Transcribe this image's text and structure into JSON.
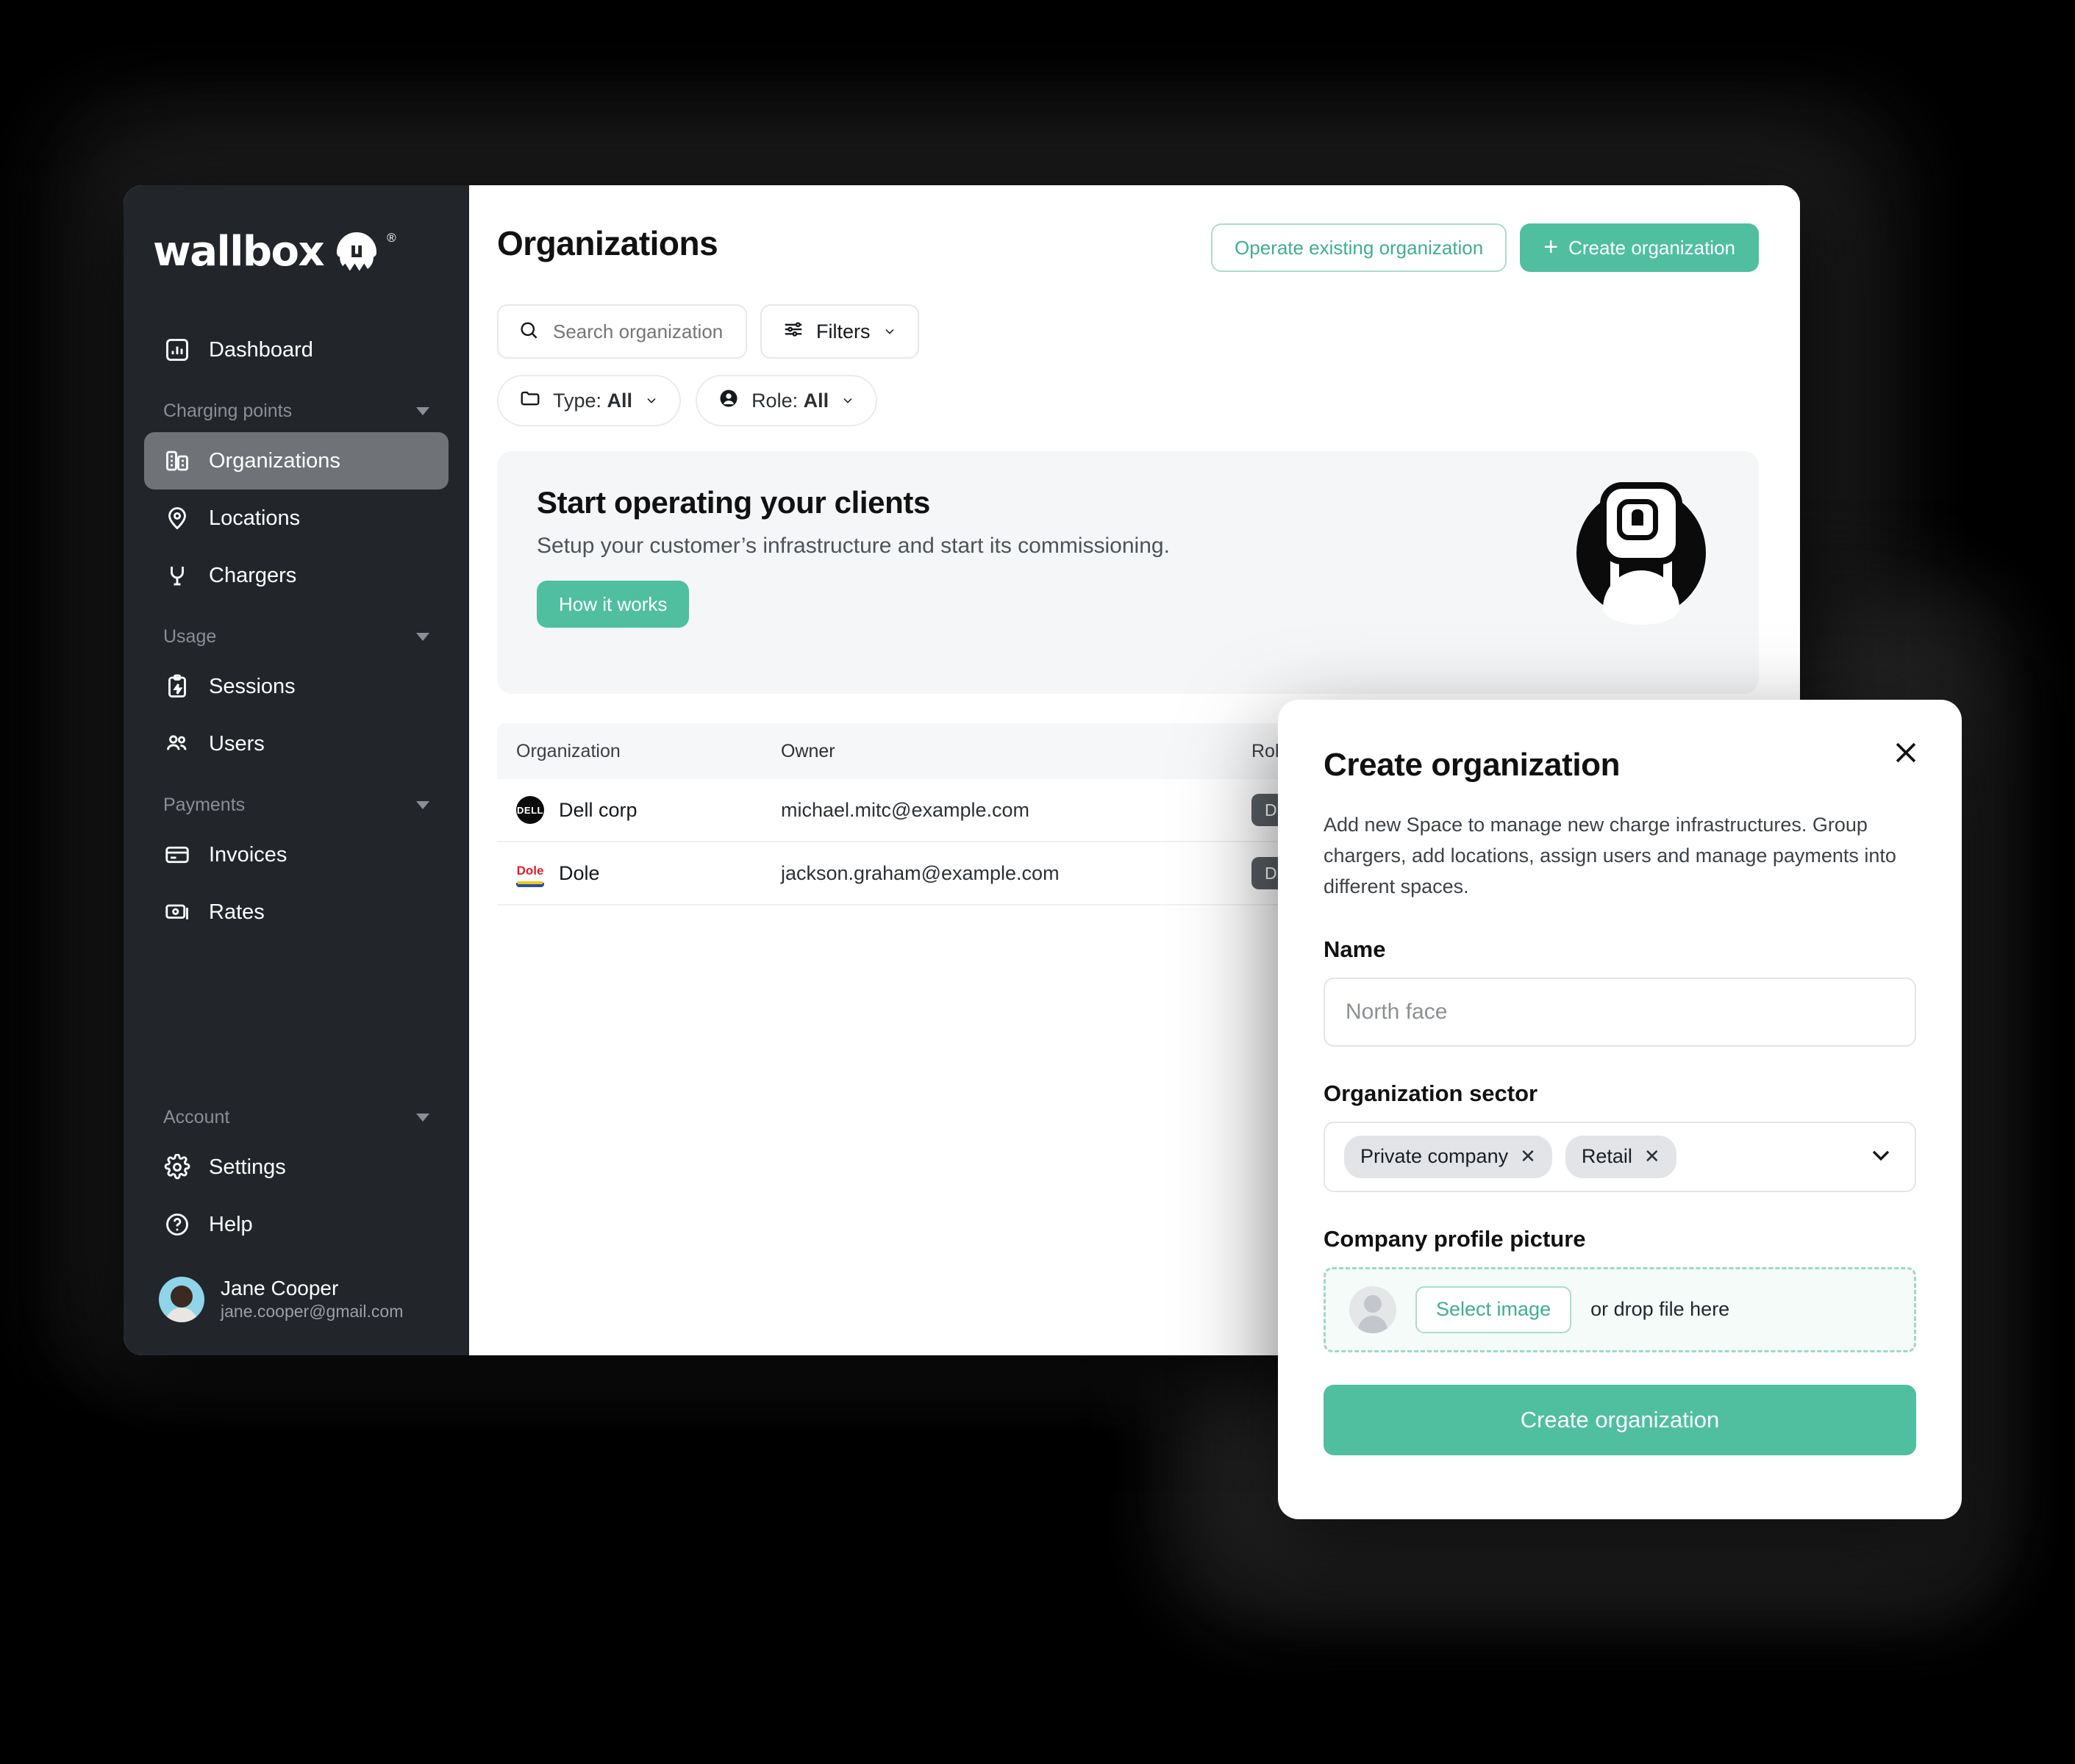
{
  "brand": {
    "name": "wallbox",
    "registered": "®",
    "accent": "#4fbfa0",
    "sidebar_bg": "#22252a"
  },
  "sidebar": {
    "items": [
      {
        "label": "Dashboard",
        "icon": "dashboard-icon",
        "type": "item",
        "active": false
      },
      {
        "label": "Charging points",
        "icon": "chevron-down-icon",
        "type": "group"
      },
      {
        "label": "Organizations",
        "icon": "organizations-icon",
        "type": "item",
        "active": true
      },
      {
        "label": "Locations",
        "icon": "location-pin-icon",
        "type": "item",
        "active": false
      },
      {
        "label": "Chargers",
        "icon": "plug-icon",
        "type": "item",
        "active": false
      },
      {
        "label": "Usage",
        "icon": "chevron-down-icon",
        "type": "group"
      },
      {
        "label": "Sessions",
        "icon": "clipboard-bolt-icon",
        "type": "item",
        "active": false
      },
      {
        "label": "Users",
        "icon": "users-icon",
        "type": "item",
        "active": false
      },
      {
        "label": "Payments",
        "icon": "chevron-down-icon",
        "type": "group"
      },
      {
        "label": "Invoices",
        "icon": "credit-card-icon",
        "type": "item",
        "active": false
      },
      {
        "label": "Rates",
        "icon": "banknote-icon",
        "type": "item",
        "active": false
      }
    ],
    "account_group": "Account",
    "account_items": [
      {
        "label": "Settings",
        "icon": "gear-icon"
      },
      {
        "label": "Help",
        "icon": "question-circle-icon"
      }
    ],
    "user": {
      "name": "Jane Cooper",
      "email": "jane.cooper@gmail.com"
    }
  },
  "page": {
    "title": "Organizations",
    "operate_button": "Operate existing organization",
    "create_button": "Create  organization"
  },
  "search": {
    "placeholder": "Search organization"
  },
  "filters": {
    "label": "Filters"
  },
  "chips": [
    {
      "prefix": "Type: ",
      "value": "All",
      "icon": "folder-icon"
    },
    {
      "prefix": "Role: ",
      "value": "All",
      "icon": "person-circle-icon"
    }
  ],
  "banner": {
    "title": "Start operating your clients",
    "subtitle": "Setup your customer’s infrastructure and start its commissioning.",
    "cta": "How it works"
  },
  "table": {
    "columns": [
      "Organization",
      "Owner",
      "Role"
    ],
    "rows": [
      {
        "organization": "Dell corp",
        "logo": "DELL",
        "owner": "michael.mitc@example.com",
        "role": "Driver"
      },
      {
        "organization": "Dole",
        "logo": "Dole",
        "owner": "jackson.graham@example.com",
        "role": "Driver"
      }
    ]
  },
  "modal": {
    "title": "Create organization",
    "description": "Add new Space to manage new charge infrastructures. Group chargers, add locations, assign users and manage payments into different spaces.",
    "name_label": "Name",
    "name_placeholder": "North face",
    "sector_label": "Organization sector",
    "sector_tags": [
      "Private company",
      "Retail"
    ],
    "tag_remove": "✕",
    "picture_label": "Company profile picture",
    "select_image": "Select image",
    "drop_hint": "or drop file here",
    "submit": "Create organization"
  }
}
